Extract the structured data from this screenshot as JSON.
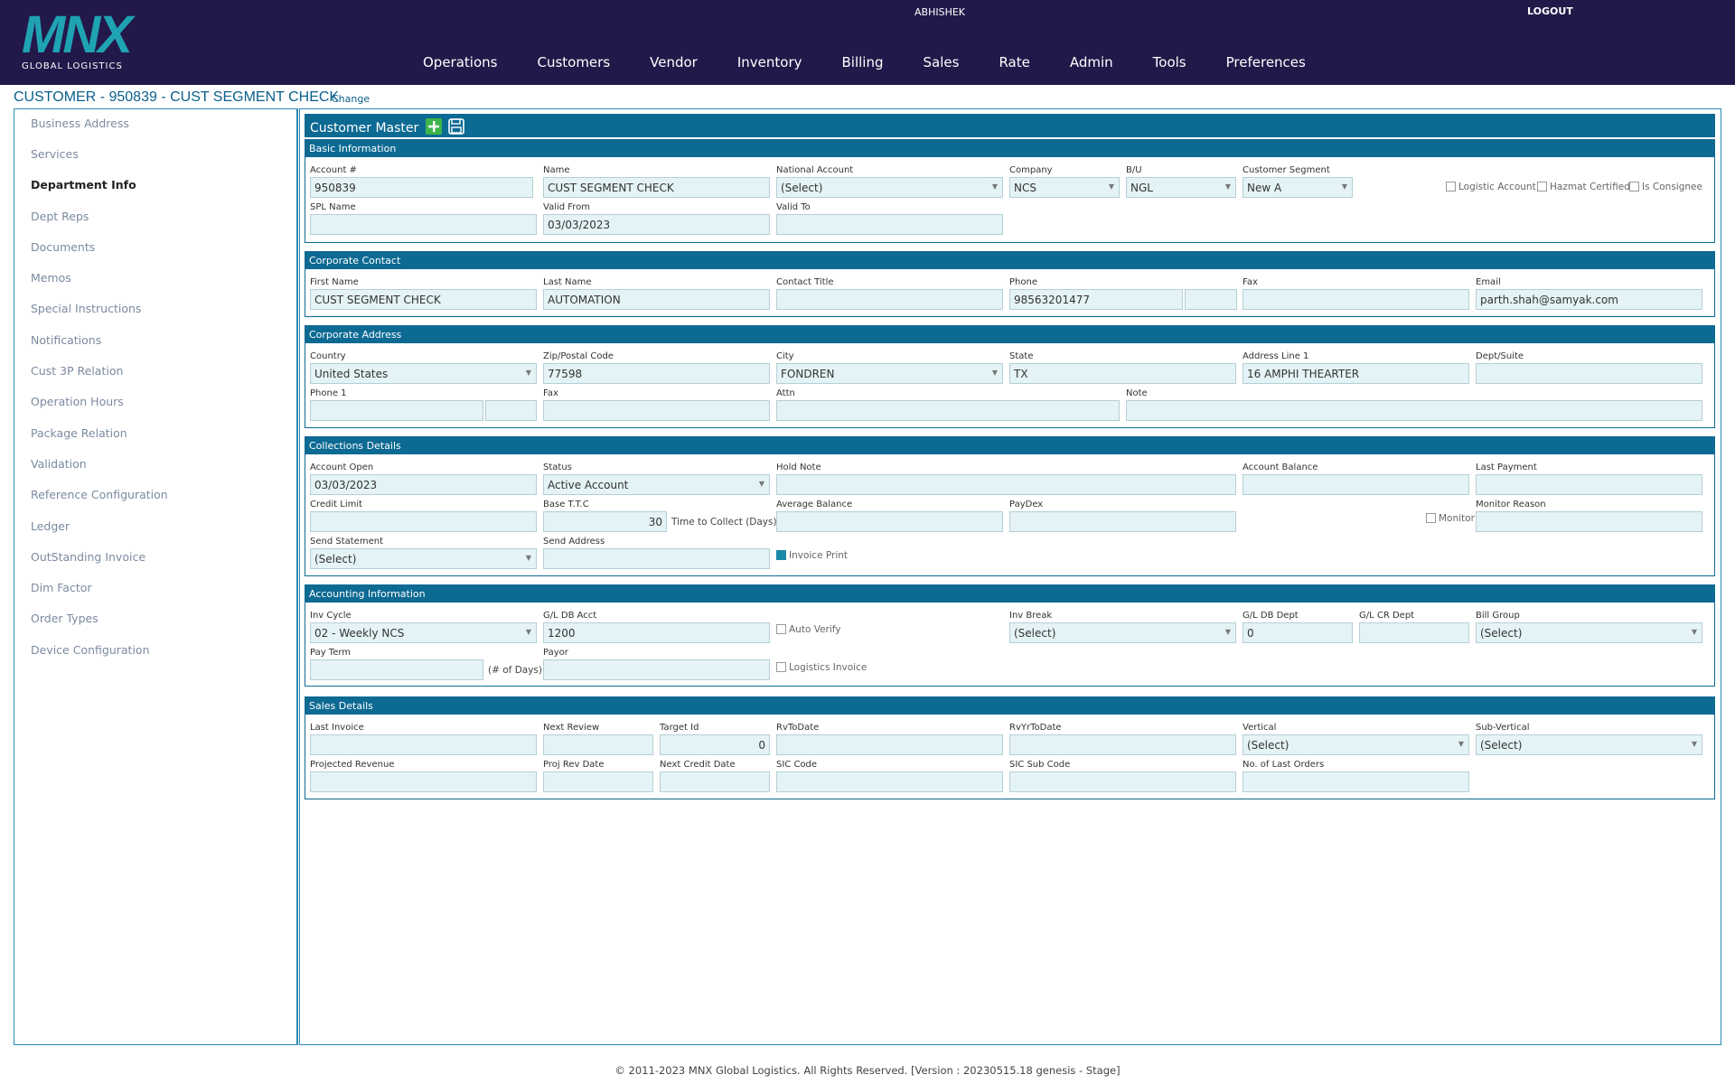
{
  "header": {
    "logo_text": "MNX",
    "logo_sub": "GLOBAL LOGISTICS",
    "user": "ABHISHEK",
    "logout": "LOGOUT",
    "nav": [
      "Operations",
      "Customers",
      "Vendor",
      "Inventory",
      "Billing",
      "Sales",
      "Rate",
      "Admin",
      "Tools",
      "Preferences"
    ]
  },
  "page": {
    "title": "CUSTOMER - 950839 - CUST SEGMENT CHECK",
    "change": "Change"
  },
  "sidebar": [
    "Business Address",
    "Services",
    "Department Info",
    "Dept Reps",
    "Documents",
    "Memos",
    "Special Instructions",
    "Notifications",
    "Cust 3P Relation",
    "Operation Hours",
    "Package Relation",
    "Validation",
    "Reference Configuration",
    "Ledger",
    "OutStanding Invoice",
    "Dim Factor",
    "Order Types",
    "Device Configuration"
  ],
  "customer_master": "Customer Master",
  "basic": {
    "title": "Basic Information",
    "account_lbl": "Account #",
    "account": "950839",
    "name_lbl": "Name",
    "name": "CUST SEGMENT CHECK",
    "national_lbl": "National Account",
    "national": "(Select)",
    "company_lbl": "Company",
    "company": "NCS",
    "bu_lbl": "B/U",
    "bu": "NGL",
    "segment_lbl": "Customer Segment",
    "segment": "New A",
    "logistic": "Logistic Account",
    "hazmat": "Hazmat Certified",
    "consignee": "Is Consignee",
    "spl_lbl": "SPL Name",
    "spl": "",
    "valid_from_lbl": "Valid From",
    "valid_from": "03/03/2023",
    "valid_to_lbl": "Valid To",
    "valid_to": ""
  },
  "contact": {
    "title": "Corporate Contact",
    "first_lbl": "First Name",
    "first": "CUST SEGMENT CHECK",
    "last_lbl": "Last Name",
    "last": "AUTOMATION",
    "ctitle_lbl": "Contact Title",
    "ctitle": "",
    "phone_lbl": "Phone",
    "phone": "98563201477",
    "fax_lbl": "Fax",
    "fax": "",
    "email_lbl": "Email",
    "email": "parth.shah@samyak.com"
  },
  "address": {
    "title": "Corporate Address",
    "country_lbl": "Country",
    "country": "United States",
    "zip_lbl": "Zip/Postal Code",
    "zip": "77598",
    "city_lbl": "City",
    "city": "FONDREN",
    "state_lbl": "State",
    "state": "TX",
    "addr1_lbl": "Address Line 1",
    "addr1": "16 AMPHI THEARTER",
    "dept_lbl": "Dept/Suite",
    "dept": "",
    "phone1_lbl": "Phone 1",
    "fax_lbl": "Fax",
    "attn_lbl": "Attn",
    "note_lbl": "Note"
  },
  "collections": {
    "title": "Collections Details",
    "open_lbl": "Account Open",
    "open": "03/03/2023",
    "status_lbl": "Status",
    "status": "Active Account",
    "hold_lbl": "Hold Note",
    "balance_lbl": "Account Balance",
    "lastpay_lbl": "Last Payment",
    "credit_lbl": "Credit Limit",
    "ttc_lbl": "Base T.T.C",
    "ttc": "30",
    "ttc_note": "Time to Collect (Days)",
    "avg_lbl": "Average Balance",
    "paydex_lbl": "PayDex",
    "monitor": "Monitor",
    "monitor_reason_lbl": "Monitor Reason",
    "stmt_lbl": "Send Statement",
    "stmt": "(Select)",
    "send_addr_lbl": "Send Address",
    "invoice_print": "Invoice Print"
  },
  "accounting": {
    "title": "Accounting Information",
    "cycle_lbl": "Inv Cycle",
    "cycle": "02 - Weekly NCS",
    "gldb_lbl": "G/L DB Acct",
    "gldb": "1200",
    "auto_verify": "Auto Verify",
    "break_lbl": "Inv Break",
    "break": "(Select)",
    "gldbdept_lbl": "G/L DB Dept",
    "gldbdept": "0",
    "glcrdept_lbl": "G/L CR Dept",
    "billgroup_lbl": "Bill Group",
    "billgroup": "(Select)",
    "payterm_lbl": "Pay Term",
    "payterm_note": "(# of Days)",
    "payor_lbl": "Payor",
    "logistics_invoice": "Logistics Invoice"
  },
  "sales": {
    "title": "Sales Details",
    "lastinv_lbl": "Last Invoice",
    "nextrev_lbl": "Next Review",
    "target_lbl": "Target Id",
    "target": "0",
    "rvto_lbl": "RvToDate",
    "rvyr_lbl": "RvYrToDate",
    "vertical_lbl": "Vertical",
    "vertical": "(Select)",
    "subvertical_lbl": "Sub-Vertical",
    "subvertical": "(Select)",
    "projrev_lbl": "Projected Revenue",
    "projrevdate_lbl": "Proj Rev Date",
    "nextcredit_lbl": "Next Credit Date",
    "sic_lbl": "SIC Code",
    "sicsub_lbl": "SIC Sub Code",
    "lastorders_lbl": "No. of Last Orders"
  },
  "footer": "© 2011-2023 MNX Global Logistics. All Rights Reserved. [Version : 20230515.18 genesis - Stage]"
}
